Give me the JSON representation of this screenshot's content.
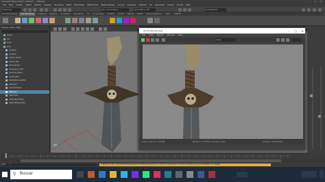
{
  "window": {
    "title": "Autodesk Maya 2020: untitled* --- pPlane1"
  },
  "menubar": [
    "File",
    "Edit",
    "Create",
    "Select",
    "Modify",
    "Display",
    "Windows",
    "Mesh",
    "Edit Mesh",
    "Mesh Tools",
    "Mesh Display",
    "Curves",
    "Surfaces",
    "Deform",
    "UV",
    "Generate",
    "Cache",
    "Arnold",
    "Help"
  ],
  "statusline": {
    "mode": "Modeling",
    "symmetry": "Symmetry: Off",
    "no_live": "No Live Surface",
    "login": "jackpascal"
  },
  "shelf_tabs": [
    "Curves/Surfaces",
    "Poly Modeling",
    "Sculpting",
    "Rigging",
    "Animation",
    "Rendering",
    "FX",
    "FX Caching",
    "Custom",
    "Arnold",
    "Bifrost",
    "MASH",
    "Motion Graphics",
    "XGen",
    "TURTLE"
  ],
  "outliner": {
    "menu": [
      "Display",
      "Show",
      "Help"
    ],
    "rows": [
      {
        "label": "persp",
        "selected": false
      },
      {
        "label": "top",
        "selected": false
      },
      {
        "label": "front",
        "selected": false
      },
      {
        "label": "side",
        "selected": false
      },
      {
        "label": "pCube1",
        "selected": false
      },
      {
        "label": "pCube2",
        "selected": false
      },
      {
        "label": "sword_blade",
        "selected": false
      },
      {
        "label": "sword_hilt",
        "selected": false
      },
      {
        "label": "skull_guard",
        "selected": false
      },
      {
        "label": "wrapping_cloth",
        "selected": false
      },
      {
        "label": "pommel_bone",
        "selected": false
      },
      {
        "label": "pCylinder1",
        "selected": false
      },
      {
        "label": "aiSkyDomeLight1",
        "selected": false
      },
      {
        "label": "pPlane1",
        "selected": false
      },
      {
        "label": "polySurface1",
        "selected": false
      },
      {
        "label": "pPlane2",
        "selected": true
      },
      {
        "label": "pSphere1",
        "selected": false
      },
      {
        "label": "defaultLightSet",
        "selected": false
      },
      {
        "label": "defaultObjectSet",
        "selected": false
      }
    ]
  },
  "arnold": {
    "title": "Arnold RenderView",
    "menu": [
      "File",
      "View",
      "Render",
      "Window",
      "Help"
    ],
    "camera": "persp",
    "status_left": "Frame: 1 Memory: 753 MB",
    "status_mid": "Render 1 | 0:05 Min | Camera: persp",
    "status_right": "Samples: [3/2/2/2/2/2]"
  },
  "cmdline": {
    "warning": "// Warning: file: /maya/scripts/others/performAiRender.mel line 1: Some nodes had errors while rendering; see Script Editor for details."
  },
  "taskbar": {
    "search_placeholder": "Buscar"
  },
  "colors": {
    "accent": "#5285a6",
    "warning": "#e1ad3c",
    "bg": "#444444"
  }
}
